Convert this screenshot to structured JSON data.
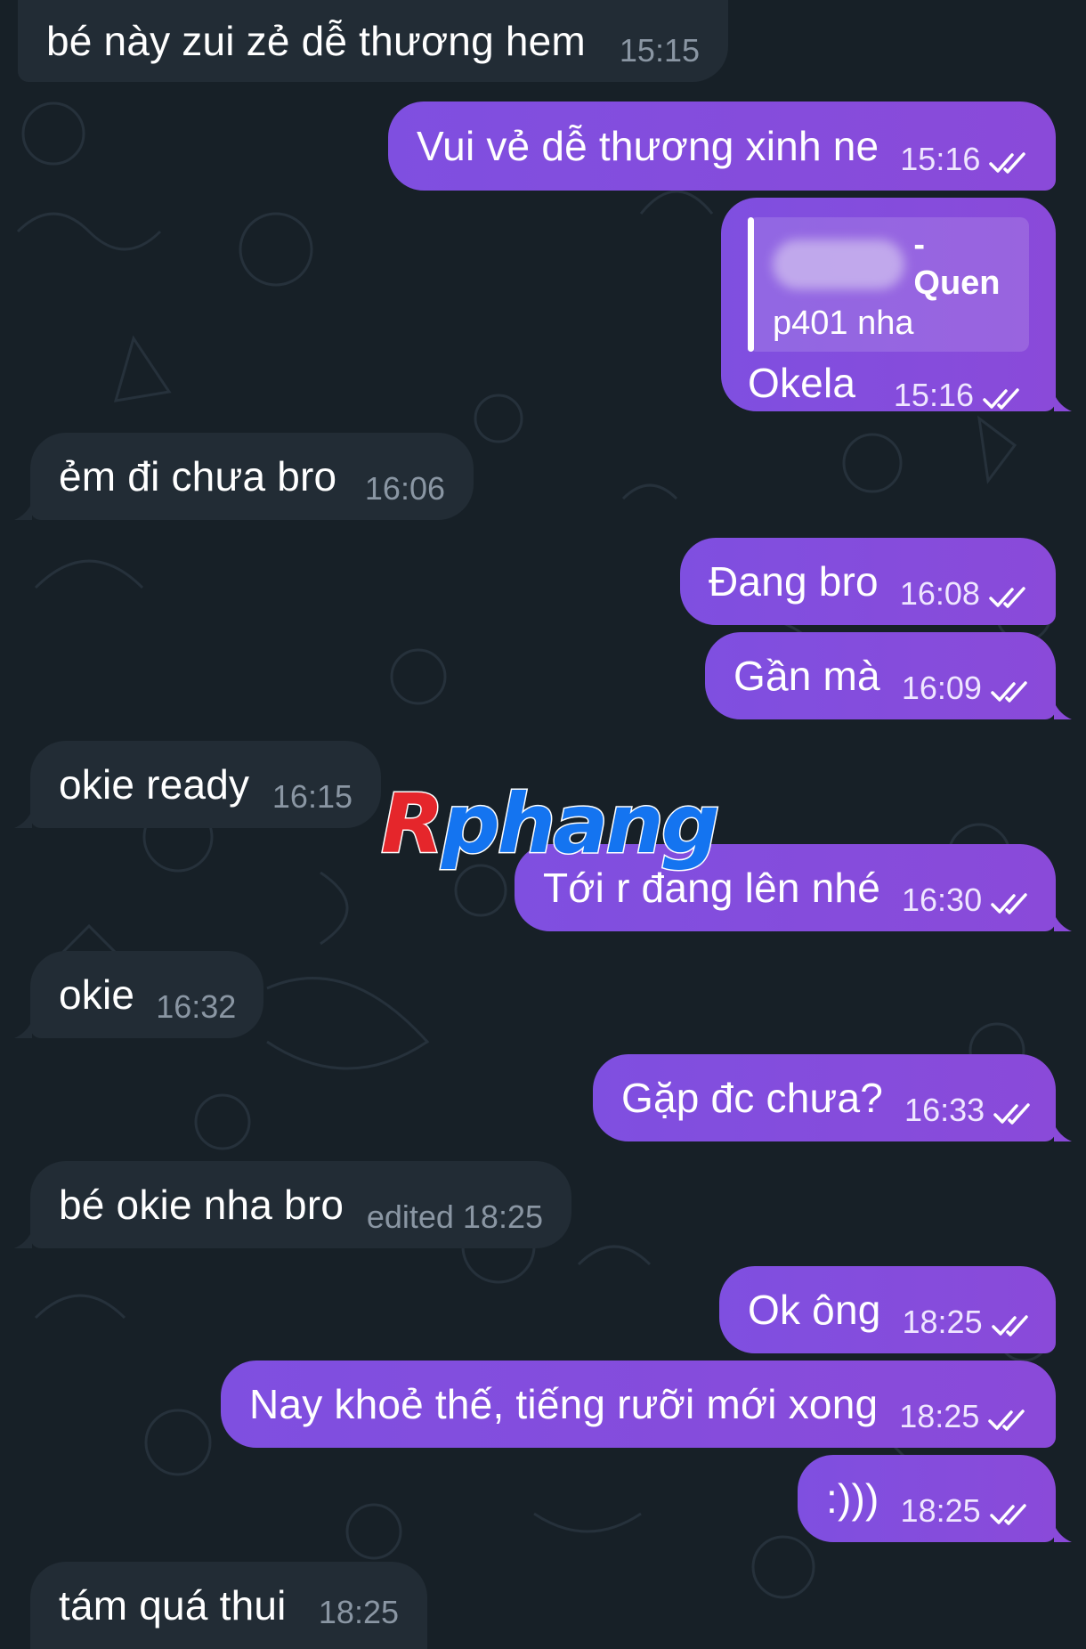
{
  "watermark": {
    "letter": "R",
    "rest": "phang"
  },
  "quote": {
    "author": "- Quen",
    "text": "p401 nha"
  },
  "messages": [
    {
      "dir": "in",
      "text": "bé này zui zẻ dễ thương hem",
      "time": "15:15"
    },
    {
      "dir": "out",
      "text": "Vui vẻ dễ thương xinh ne",
      "time": "15:16",
      "read": true
    },
    {
      "dir": "out",
      "text": "Okela",
      "time": "15:16",
      "read": true,
      "reply": true
    },
    {
      "dir": "in",
      "text": "ẻm đi chưa bro",
      "time": "16:06"
    },
    {
      "dir": "out",
      "text": "Đang bro",
      "time": "16:08",
      "read": true
    },
    {
      "dir": "out",
      "text": "Gần mà",
      "time": "16:09",
      "read": true
    },
    {
      "dir": "in",
      "text": "okie ready",
      "time": "16:15"
    },
    {
      "dir": "out",
      "text": "Tới r đang lên nhé",
      "time": "16:30",
      "read": true
    },
    {
      "dir": "in",
      "text": "okie",
      "time": "16:32"
    },
    {
      "dir": "out",
      "text": "Gặp đc chưa?",
      "time": "16:33",
      "read": true
    },
    {
      "dir": "in",
      "text": "bé okie nha bro",
      "time": "edited 18:25"
    },
    {
      "dir": "out",
      "text": "Ok ông",
      "time": "18:25",
      "read": true
    },
    {
      "dir": "out",
      "text": "Nay khoẻ thế, tiếng rưỡi mới xong",
      "time": "18:25",
      "read": true
    },
    {
      "dir": "out",
      "text": ":)))",
      "time": "18:25",
      "read": true
    },
    {
      "dir": "in",
      "text": "tám quá thui",
      "time": "18:25"
    }
  ]
}
